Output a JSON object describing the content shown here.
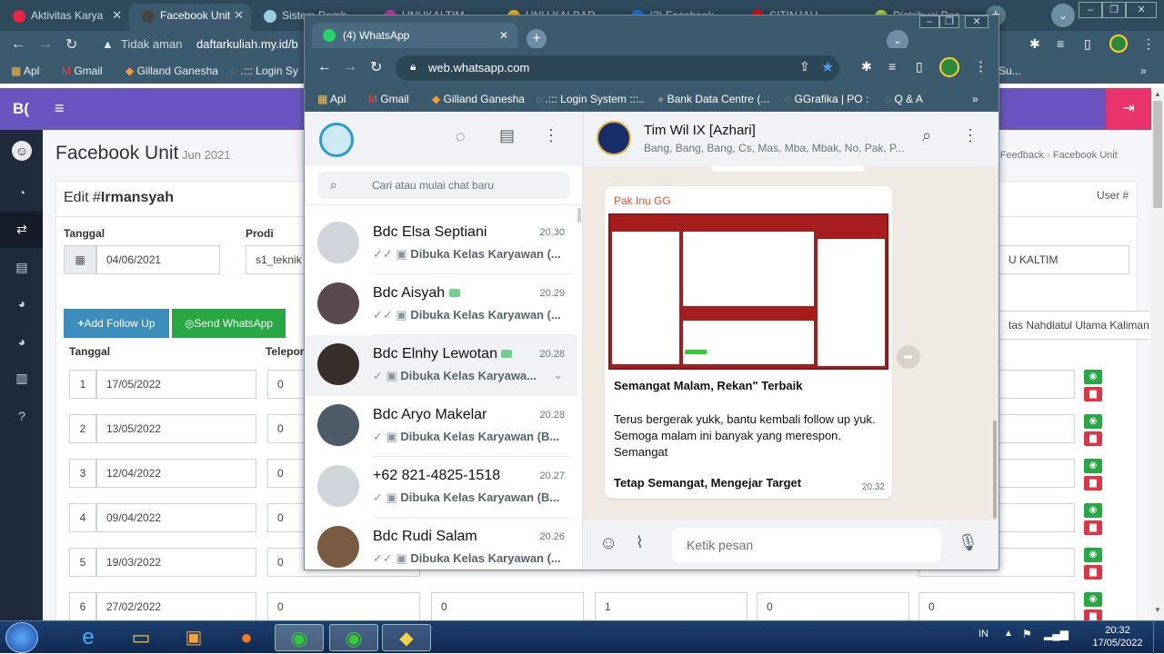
{
  "bg_browser": {
    "tabs": [
      "Aktivitas Karya",
      "Facebook Unit",
      "Sistem Pemb",
      "UNUKALTIM",
      "UNU KALBAR",
      "(2) Facebook",
      "SITINJAU",
      "Distribusi Pos"
    ],
    "address_warning": "Tidak aman",
    "address_host": "daftarkuliah.my.id/b",
    "bookmarks": [
      "Apl",
      "Gmail",
      "Gilland Ganesha",
      ".::: Login Sy"
    ],
    "bookmark_right": "Su..."
  },
  "admin": {
    "logo": "B(",
    "page_title": "Facebook Unit",
    "page_subtitle": "Jun 2021",
    "breadcrumb": [
      "Feedback",
      "Facebook Unit"
    ],
    "edit_prefix": "Edit #",
    "edit_name": "Irmansyah",
    "user_label": "User #",
    "tanggal_label": "Tanggal",
    "tanggal_value": "04/06/2021",
    "prodi_label": "Prodi",
    "prodi_value": "s1_teknik",
    "kaltim_value": "U KALTIM",
    "univ_value": "tas Nahdlatul Ulama Kalimantan",
    "add_followup": "Add Follow Up",
    "send_whatsapp": "Send WhatsApp",
    "col_tanggal": "Tanggal",
    "col_telepon": "Telepon",
    "rows": [
      {
        "no": "1",
        "date": "17/05/2022",
        "tel": "0"
      },
      {
        "no": "2",
        "date": "13/05/2022",
        "tel": "0"
      },
      {
        "no": "3",
        "date": "12/04/2022",
        "tel": "0"
      },
      {
        "no": "4",
        "date": "09/04/2022",
        "tel": "0"
      },
      {
        "no": "5",
        "date": "19/03/2022",
        "tel": "0"
      },
      {
        "no": "6",
        "date": "27/02/2022",
        "tel": "0",
        "c2": "0",
        "c3": "1",
        "c4": "0",
        "c5": "0"
      }
    ]
  },
  "whatsapp_browser": {
    "tab_title": "(4) WhatsApp",
    "url": "web.whatsapp.com",
    "bookmarks": [
      "Apl",
      "Gmail",
      "Gilland Ganesha",
      ".::: Login System :::..",
      "Bank Data Centre (...",
      "GGrafika | PO :",
      "Q & A"
    ]
  },
  "whatsapp": {
    "search_placeholder": "Cari atau mulai chat baru",
    "chats": [
      {
        "name": "Bdc Elsa Septiani",
        "time": "20.30",
        "msg": "Dibuka Kelas Karyawan (..."
      },
      {
        "name": "Bdc Aisyah",
        "time": "20.29",
        "msg": "Dibuka Kelas Karyawan (..."
      },
      {
        "name": "Bdc Elnhy Lewotan",
        "time": "20.28",
        "msg": "Dibuka Kelas Karyawa..."
      },
      {
        "name": "Bdc Aryo Makelar",
        "time": "20.28",
        "msg": "Dibuka Kelas Karyawan (B..."
      },
      {
        "name": "+62 821-4825-1518",
        "time": "20.27",
        "msg": "Dibuka Kelas Karyawan (B..."
      },
      {
        "name": "Bdc Rudi Salam",
        "time": "20.26",
        "msg": "Dibuka Kelas Karyawan (..."
      }
    ],
    "group_name": "Tim Wil IX [Azhari]",
    "group_members": "Bang, Bang, Bang, Cs, Mas, Mba, Mbak, No, Pak, P...",
    "message": {
      "sender": "Pak Inu GG",
      "heading": "Semangat Malam, Rekan\" Terbaik",
      "body": "Terus bergerak yukk, bantu kembali follow up yuk. Semoga malam ini banyak yang merespon. Semangat",
      "footer": "Tetap Semangat, Mengejar Target",
      "time": "20.32"
    },
    "compose_placeholder": "Ketik pesan"
  },
  "taskbar": {
    "lang": "IN",
    "time": "20:32",
    "date": "17/05/2022"
  }
}
